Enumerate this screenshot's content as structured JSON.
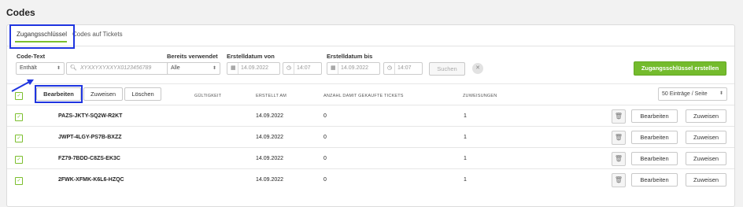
{
  "page": {
    "title": "Codes"
  },
  "tabs": [
    {
      "label": "Zugangsschlüssel",
      "active": true
    },
    {
      "label": "Codes auf Tickets",
      "active": false
    }
  ],
  "filters": {
    "code_text_label": "Code-Text",
    "code_match_select": "Enthält",
    "code_search_placeholder": "XYXXYXYXXYX0123456789",
    "used_label": "Bereits verwendet",
    "used_select": "Alle",
    "created_from_label": "Erstelldatum von",
    "created_from_date": "14.09.2022",
    "created_from_time": "14:07",
    "created_to_label": "Erstelldatum bis",
    "created_to_date": "14.09.2022",
    "created_to_time": "14:07",
    "search_label": "Suchen",
    "clear_icon": "close-icon",
    "create_label": "Zugangsschlüssel erstellen"
  },
  "bulk_actions": {
    "edit_label": "Bearbeiten",
    "assign_label": "Zuweisen",
    "delete_label": "Löschen"
  },
  "table": {
    "headers": {
      "validity": "GÜLTIGKEIT",
      "created": "ERSTELLT AM",
      "tickets": "ANZAHL DAMIT GEKAUFTE TICKETS",
      "assignments": "ZUWEISUNGEN"
    },
    "page_size": "50 Einträge / Seite",
    "rows": [
      {
        "code": "PAZS-JKTY-SQ2W-R2KT",
        "created": "14.09.2022",
        "tickets": "0",
        "assignments": "1"
      },
      {
        "code": "JWPT-4LGY-PS7B-BXZZ",
        "created": "14.09.2022",
        "tickets": "0",
        "assignments": "1"
      },
      {
        "code": "FZ79-7BDD-C8ZS-EK3C",
        "created": "14.09.2022",
        "tickets": "0",
        "assignments": "1"
      },
      {
        "code": "2FWK-XFMK-K6L6-HZQC",
        "created": "14.09.2022",
        "tickets": "0",
        "assignments": "1"
      }
    ],
    "row_edit_label": "Bearbeiten",
    "row_assign_label": "Zuweisen"
  },
  "colors": {
    "accent": "#74bb2d",
    "highlight": "#1f35e0"
  }
}
